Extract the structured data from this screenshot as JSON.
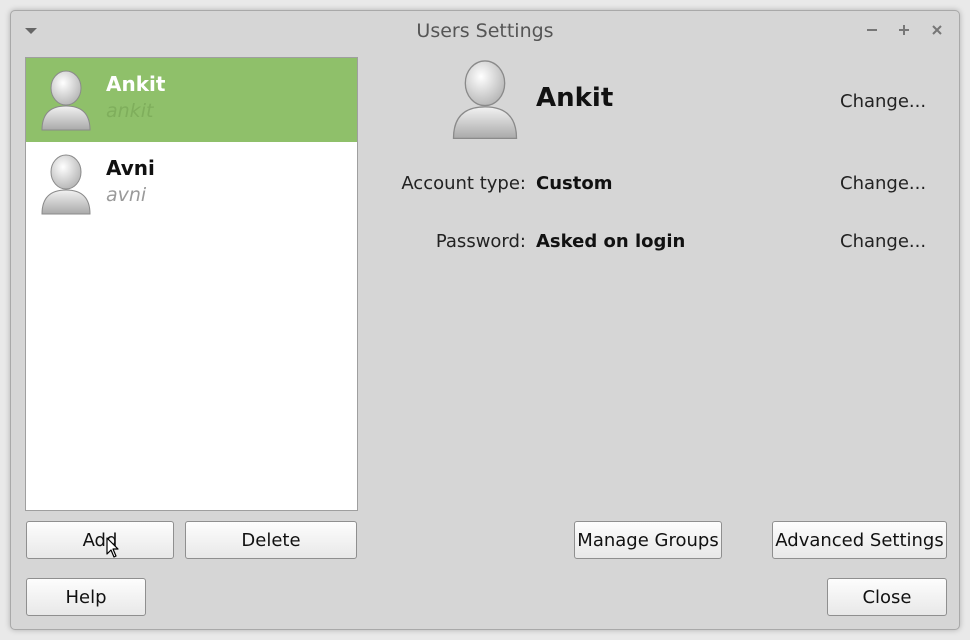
{
  "window": {
    "title": "Users Settings"
  },
  "users": [
    {
      "name": "Ankit",
      "login": "ankit",
      "selected": true
    },
    {
      "name": "Avni",
      "login": "avni",
      "selected": false
    }
  ],
  "details": {
    "name": "Ankit",
    "account_type_label": "Account type:",
    "account_type_value": "Custom",
    "password_label": "Password:",
    "password_value": "Asked on login",
    "change_label": "Change..."
  },
  "buttons": {
    "add": "Add",
    "delete": "Delete",
    "manage_groups": "Manage Groups",
    "advanced_settings": "Advanced Settings",
    "help": "Help",
    "close": "Close"
  },
  "colors": {
    "selection": "#8fc06a",
    "window_bg": "#d6d6d6"
  },
  "icons": [
    "window-menu-icon",
    "minimize-icon",
    "maximize-icon",
    "close-icon",
    "user-avatar-icon",
    "mouse-cursor-icon"
  ]
}
